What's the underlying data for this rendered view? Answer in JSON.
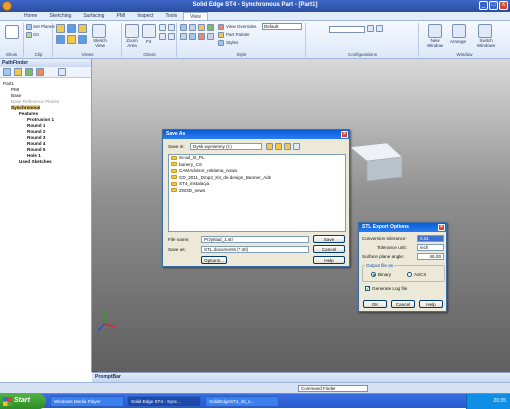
{
  "window": {
    "title": "Solid Edge ST4 - Synchronous Part - [Part1]",
    "controls": [
      "_",
      "□",
      "X"
    ]
  },
  "tabs": [
    {
      "label": "Home",
      "active": false
    },
    {
      "label": "Sketching",
      "active": false
    },
    {
      "label": "Surfacing",
      "active": false
    },
    {
      "label": "PMI",
      "active": false
    },
    {
      "label": "Inspect",
      "active": false
    },
    {
      "label": "Tools",
      "active": false
    },
    {
      "label": "View",
      "active": true
    }
  ],
  "ribbon": {
    "groups": [
      "Show",
      "Clip",
      "Views",
      "Orient",
      "Style",
      "Configurations",
      "Window"
    ],
    "show": {
      "set_planes": "Set Planes",
      "on": "On"
    },
    "views": {
      "sketch_view": "Sketch View"
    },
    "orient": {
      "zoom_area": "Zoom Area",
      "fit": "Fit"
    },
    "style": {
      "view_overrides_label": "View Overrides",
      "view_overrides_value": "Default",
      "part_painter": "Part Painter",
      "styles": "Styles"
    },
    "window": {
      "new_window": "New Window",
      "arrange": "Arrange",
      "switch_windows": "Switch Windows"
    }
  },
  "pathfinder": {
    "title": "PathFinder",
    "tree": [
      {
        "label": "Part1",
        "indent": 0,
        "style": "normal"
      },
      {
        "label": "PMI",
        "indent": 1,
        "style": "normal"
      },
      {
        "label": "Base",
        "indent": 1,
        "style": "normal"
      },
      {
        "label": "Base Reference Planes",
        "indent": 1,
        "style": "faded"
      },
      {
        "label": "Synchronous",
        "indent": 1,
        "style": "selected"
      },
      {
        "label": "Features",
        "indent": 2,
        "style": "bold"
      },
      {
        "label": "Protrusion 1",
        "indent": 3,
        "style": "bold"
      },
      {
        "label": "Round 1",
        "indent": 3,
        "style": "bold"
      },
      {
        "label": "Round 2",
        "indent": 3,
        "style": "bold"
      },
      {
        "label": "Round 3",
        "indent": 3,
        "style": "bold"
      },
      {
        "label": "Round 4",
        "indent": 3,
        "style": "bold"
      },
      {
        "label": "Round 5",
        "indent": 3,
        "style": "bold"
      },
      {
        "label": "Hole 1",
        "indent": 3,
        "style": "bold"
      },
      {
        "label": "Used Sketches",
        "indent": 2,
        "style": "bold"
      }
    ]
  },
  "save_as": {
    "title": "Save As",
    "save_in_label": "Save in:",
    "save_in_value": "Dysk wymienny (I:)",
    "folders": [
      "ss-ad_st_PL",
      "banery_CS",
      "CAMAdvisor_reklama_nowa",
      "CD_2011_Dmp2_Kit_ds-design_Banner_Ads",
      "ST4_instalacja",
      "ZW3D_news"
    ],
    "file_name_label": "File name:",
    "file_name_value": "Przyklad_1.stl",
    "save_as_label": "Save as:",
    "save_as_value": "STL documents (*.stl)",
    "save_button": "Save",
    "cancel_button": "Cancel",
    "options_button": "Options...",
    "help_button": "Help"
  },
  "stl_options": {
    "title": "STL Export Options",
    "conversion_tolerance_label": "Conversion tolerance:",
    "conversion_tolerance_value": "0.01",
    "tolerance_unit_label": "Tolerance unit:",
    "tolerance_unit_value": "inch",
    "surface_angle_label": "Surface plane angle:",
    "surface_angle_value": "45.00",
    "output_group_label": "Output file as",
    "binary_label": "Binary",
    "ascii_label": "ASCII",
    "binary_selected": true,
    "generate_log_label": "Generate Log file",
    "generate_log_checked": true,
    "ok_button": "OK",
    "cancel_button": "Cancel",
    "help_button": "Help"
  },
  "promptbar": {
    "title": "PromptBar"
  },
  "command_finder": "Command Finder",
  "taskbar": {
    "start": "Start",
    "buttons": [
      {
        "label": "Windows Media Player",
        "active": false
      },
      {
        "label": "Solid Edge ST4 - Sync...",
        "active": true
      },
      {
        "label": "SolidEdgeST4_stl_s...",
        "active": false
      }
    ],
    "clock": "20:35"
  },
  "colors": {
    "accent": "#2a4f9f",
    "selection": "#f3d679",
    "taskbar": "#245ad3",
    "start": "#3a9a30"
  }
}
